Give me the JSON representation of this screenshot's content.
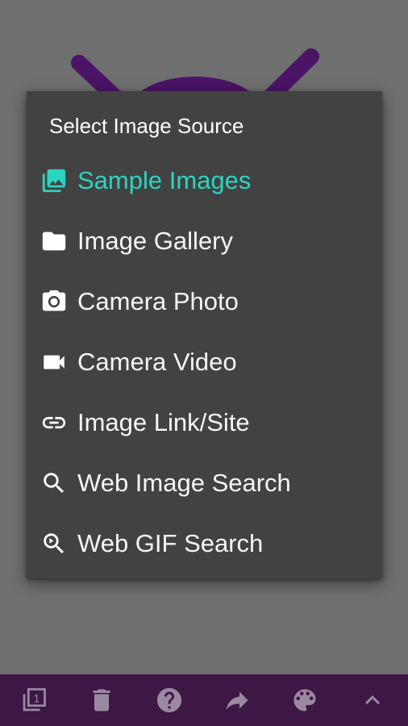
{
  "menu": {
    "title": "Select Image Source",
    "items": [
      {
        "label": "Sample Images",
        "icon": "image-icon",
        "selected": true
      },
      {
        "label": "Image Gallery",
        "icon": "folder-icon",
        "selected": false
      },
      {
        "label": "Camera Photo",
        "icon": "camera-icon",
        "selected": false
      },
      {
        "label": "Camera Video",
        "icon": "videocam-icon",
        "selected": false
      },
      {
        "label": "Image Link/Site",
        "icon": "link-icon",
        "selected": false
      },
      {
        "label": "Web Image Search",
        "icon": "search-icon",
        "selected": false
      },
      {
        "label": "Web GIF Search",
        "icon": "gif-search-icon",
        "selected": false
      }
    ]
  },
  "bottom_bar": {
    "buttons": [
      {
        "icon": "layers-icon",
        "badge": "1"
      },
      {
        "icon": "delete-icon"
      },
      {
        "icon": "help-icon"
      },
      {
        "icon": "share-icon"
      },
      {
        "icon": "palette-icon"
      },
      {
        "icon": "chevron-up-icon"
      }
    ]
  },
  "colors": {
    "accent": "#2bd4c0",
    "menu_bg": "#424242",
    "bottom_bar_bg": "#3d1844",
    "overlay": "#6f6f6f",
    "background_art": "#4b1466"
  }
}
